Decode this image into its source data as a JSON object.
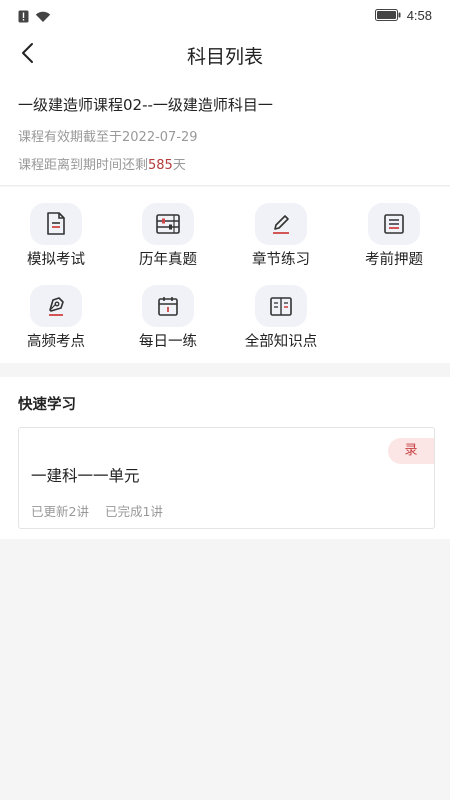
{
  "status_bar": {
    "time": "4:58",
    "icons": [
      "sim-alert-icon",
      "wifi-icon",
      "battery-icon"
    ]
  },
  "nav": {
    "title": "科目列表",
    "back_icon": "chevron-left-icon"
  },
  "course": {
    "title": "一级建造师课程02--一级建造师科目一",
    "valid_text": "课程有效期截至于2022-07-29",
    "remain_prefix": "课程距离到期时间还剩",
    "remain_days": "585",
    "remain_suffix": "天"
  },
  "menu": {
    "items": [
      {
        "label": "模拟考试",
        "icon": "exam-paper-icon"
      },
      {
        "label": "历年真题",
        "icon": "abacus-icon"
      },
      {
        "label": "章节练习",
        "icon": "pencil-edit-icon"
      },
      {
        "label": "考前押题",
        "icon": "document-list-icon"
      },
      {
        "label": "高频考点",
        "icon": "pen-nib-icon"
      },
      {
        "label": "每日一练",
        "icon": "calendar-icon"
      },
      {
        "label": "全部知识点",
        "icon": "open-book-icon"
      }
    ]
  },
  "quick_study": {
    "title": "快速学习",
    "units": [
      {
        "badge": "录",
        "name": "一建科一一单元",
        "updated": "已更新2讲",
        "completed": "已完成1讲"
      }
    ]
  },
  "colors": {
    "accent_red": "#b53a3a",
    "badge_bg": "#fbe5e5",
    "icon_tile_bg": "#f1f2f7"
  }
}
